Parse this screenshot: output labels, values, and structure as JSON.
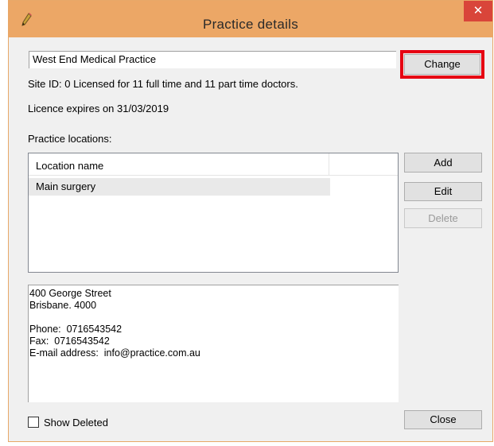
{
  "window": {
    "title": "Practice details",
    "close_glyph": "✕",
    "icon": "pencil-icon",
    "accent_color": "#eca766",
    "close_color": "#d9453a"
  },
  "practice": {
    "name": "West End Medical Practice",
    "change_label": "Change",
    "site_line": "Site ID: 0    Licensed for 11 full time and 11 part time doctors.",
    "licence_line": "Licence expires on 31/03/2019"
  },
  "locations": {
    "heading": "Practice locations:",
    "column_header": "Location name",
    "rows": [
      "Main surgery"
    ],
    "add_label": "Add",
    "edit_label": "Edit",
    "delete_label": "Delete"
  },
  "address": {
    "text": "400 George Street\nBrisbane. 4000\n\nPhone:  0716543542\nFax:  0716543542\nE-mail address:  info@practice.com.au"
  },
  "footer": {
    "show_deleted_label": "Show Deleted",
    "show_deleted_checked": false,
    "close_label": "Close"
  },
  "highlight_color": "#e60012"
}
